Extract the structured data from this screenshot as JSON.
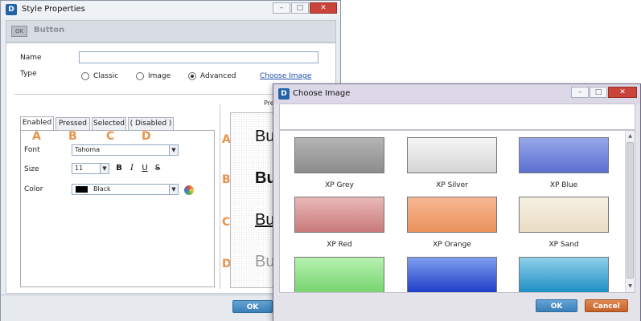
{
  "style_properties": {
    "title": "Style Properties",
    "logo": "D",
    "header": {
      "ok_chip": "OK",
      "title": "Button"
    },
    "form": {
      "name_label": "Name",
      "name_value": "",
      "type_label": "Type",
      "type_options": [
        "Classic",
        "Image",
        "Advanced"
      ],
      "type_selected": "Advanced",
      "choose_image_link": "Choose Image"
    },
    "tabs": [
      "Enabled",
      "Pressed",
      "Selected",
      "( Disabled )"
    ],
    "active_tab": "Enabled",
    "tab_letters": [
      "A",
      "B",
      "C",
      "D"
    ],
    "font_label": "Font",
    "font_value": "Tahoma",
    "size_label": "Size",
    "size_value": "11",
    "format_buttons": [
      "B",
      "I",
      "U",
      "S"
    ],
    "color_label": "Color",
    "color_value": "Black",
    "color_swatch": "#000000",
    "preview_label": "Pre",
    "preview_rows": [
      {
        "letter": "A",
        "text": "Bu",
        "style": "normal"
      },
      {
        "letter": "B",
        "text": "Bu",
        "style": "bold"
      },
      {
        "letter": "C",
        "text": "Bu",
        "style": "underline"
      },
      {
        "letter": "D",
        "text": "Bu",
        "style": "disabled"
      }
    ],
    "ok_button": "OK"
  },
  "choose_image": {
    "title": "Choose Image",
    "logo": "D",
    "images": [
      {
        "label": "XP Grey",
        "color_top": "#b4b4b4",
        "color_bottom": "#8c8c8c"
      },
      {
        "label": "XP Silver",
        "color_top": "#f5f5f5",
        "color_bottom": "#d5d5d5"
      },
      {
        "label": "XP Blue",
        "color_top": "#98a8ec",
        "color_bottom": "#5b6fcf"
      },
      {
        "label": "XP Red",
        "color_top": "#eab8b8",
        "color_bottom": "#c97a7a"
      },
      {
        "label": "XP Orange",
        "color_top": "#f8b894",
        "color_bottom": "#e9925c"
      },
      {
        "label": "XP Sand",
        "color_top": "#f7f1e4",
        "color_bottom": "#e8dcc4"
      },
      {
        "label": "",
        "color_top": "#b6f2b0",
        "color_bottom": "#78d470"
      },
      {
        "label": "",
        "color_top": "#7f9ef0",
        "color_bottom": "#1f3fc8"
      },
      {
        "label": "",
        "color_top": "#8fd0ea",
        "color_bottom": "#1e8fc4"
      }
    ],
    "ok_button": "OK",
    "cancel_button": "Cancel"
  },
  "icons": {
    "window_controls": [
      "minimize-icon",
      "maximize-icon",
      "close-icon"
    ],
    "color_picker": "color-picker-icon",
    "dropdown": "chevron-down-icon"
  }
}
